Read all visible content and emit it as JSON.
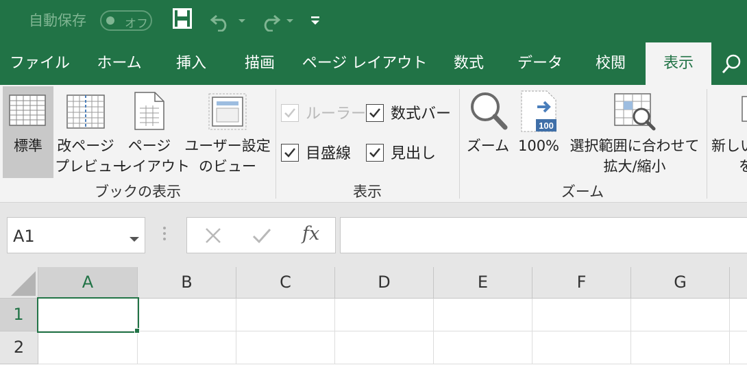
{
  "titlebar": {
    "autosave_label": "自動保存",
    "autosave_state": "オフ"
  },
  "tabs": [
    {
      "label": "ファイル"
    },
    {
      "label": "ホーム"
    },
    {
      "label": "挿入"
    },
    {
      "label": "描画"
    },
    {
      "label": "ページ レイアウト"
    },
    {
      "label": "数式"
    },
    {
      "label": "データ"
    },
    {
      "label": "校閲"
    },
    {
      "label": "表示"
    }
  ],
  "ribbon": {
    "book_views": {
      "group_label": "ブックの表示",
      "normal": "標準",
      "page_break_line1": "改ページ",
      "page_break_line2": "プレビュー",
      "page_layout_line1": "ページ",
      "page_layout_line2": "レイアウト",
      "custom_line1": "ユーザー設定",
      "custom_line2": "のビュー"
    },
    "show": {
      "group_label": "表示",
      "ruler": "ルーラー",
      "formula_bar": "数式バー",
      "gridlines": "目盛線",
      "headings": "見出し"
    },
    "zoom": {
      "group_label": "ズーム",
      "zoom": "ズーム",
      "hundred": "100%",
      "hundred_badge": "100",
      "zoom_selection_line1": "選択範囲に合わせて",
      "zoom_selection_line2": "拡大/縮小"
    },
    "window": {
      "new_window_line1": "新しい",
      "new_window_line2": "を"
    }
  },
  "formula_bar": {
    "name_box": "A1",
    "fx": "fx"
  },
  "grid": {
    "columns": [
      "A",
      "B",
      "C",
      "D",
      "E",
      "F",
      "G"
    ],
    "rows": [
      "1",
      "2"
    ]
  },
  "colors": {
    "accent": "#217346"
  }
}
